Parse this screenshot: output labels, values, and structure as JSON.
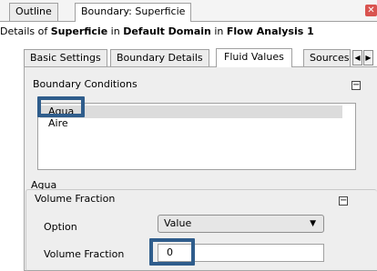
{
  "tabs": {
    "outline": "Outline",
    "boundary": "Boundary: Superficie",
    "close": "✕"
  },
  "details": {
    "prefix": "Details of ",
    "object": "Superficie",
    "in1": " in ",
    "domain": "Default Domain",
    "in2": " in ",
    "analysis": "Flow Analysis 1"
  },
  "subtabs": [
    "Basic Settings",
    "Boundary Details",
    "Fluid Values",
    "Sources"
  ],
  "active_subtab": "Fluid Values",
  "scroll_icons": [
    "◀",
    "▶"
  ],
  "boundary_conditions": {
    "title": "Boundary Conditions",
    "collapse": "−",
    "items": [
      "Agua",
      "Aire"
    ],
    "selected": "Agua"
  },
  "fluid_section": {
    "name": "Agua",
    "volume_fraction_group": {
      "title": "Volume Fraction",
      "collapse": "−",
      "option_label": "Option",
      "option_value": "Value",
      "dropdown_arrow": "▼",
      "volume_fraction_label": "Volume Fraction",
      "volume_fraction_value": "0"
    }
  },
  "colors": {
    "highlight": "#2f5d8c",
    "close_button": "#d9534f"
  }
}
